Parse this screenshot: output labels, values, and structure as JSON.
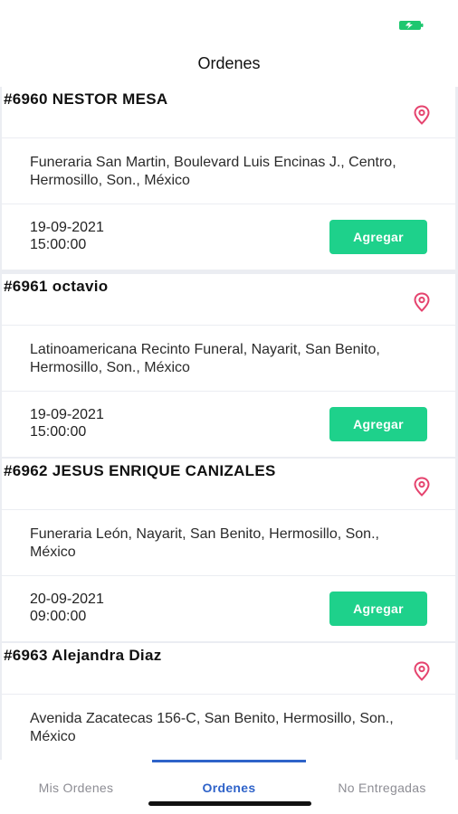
{
  "header": {
    "title": "Ordenes"
  },
  "colors": {
    "accent": "#1ed18b",
    "tab_active": "#2f63c9",
    "pin": "#e5436e"
  },
  "orders": [
    {
      "title": "#6960 NESTOR MESA",
      "address": "Funeraria San Martin, Boulevard Luis Encinas J., Centro, Hermosillo, Son., México",
      "date": "19-09-2021",
      "time": "15:00:00",
      "button": "Agregar"
    },
    {
      "title": "#6961 octavio",
      "address": "Latinoamericana Recinto Funeral, Nayarit, San Benito, Hermosillo, Son., México",
      "date": "19-09-2021",
      "time": "15:00:00",
      "button": "Agregar"
    },
    {
      "title": "#6962 JESUS ENRIQUE CANIZALES",
      "address": "Funeraria León, Nayarit, San Benito, Hermosillo, Son., México",
      "date": "20-09-2021",
      "time": "09:00:00",
      "button": "Agregar"
    },
    {
      "title": "#6963 Alejandra Diaz",
      "address": "Avenida Zacatecas 156-C, San Benito, Hermosillo, Son., México"
    }
  ],
  "tabs": [
    {
      "label": "Mis Ordenes",
      "active": false
    },
    {
      "label": "Ordenes",
      "active": true
    },
    {
      "label": "No Entregadas",
      "active": false
    }
  ]
}
